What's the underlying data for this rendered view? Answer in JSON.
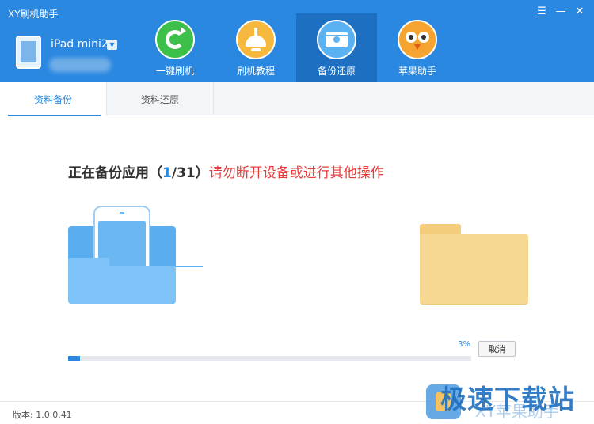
{
  "window": {
    "title": "XY刷机助手",
    "controls": [
      "menu-icon",
      "minimize-icon",
      "close-icon"
    ]
  },
  "device": {
    "name": "iPad mini2",
    "dropdown_glyph": "▼"
  },
  "nav": [
    {
      "label": "一键刷机",
      "icon": "refresh-icon",
      "color": "#3cc04a",
      "active": false
    },
    {
      "label": "刷机教程",
      "icon": "lamp-icon",
      "color": "#f7b83e",
      "active": false
    },
    {
      "label": "备份还原",
      "icon": "disk-icon",
      "color": "#5bb2f2",
      "active": true
    },
    {
      "label": "苹果助手",
      "icon": "owl-icon",
      "color": "#f5a430",
      "active": false
    }
  ],
  "tabs": [
    {
      "label": "资料备份",
      "active": true
    },
    {
      "label": "资料还原",
      "active": false
    }
  ],
  "status": {
    "prefix": "正在备份应用（",
    "current": "1",
    "separator": "/31",
    "suffix": "）",
    "warning": "请勿断开设备或进行其他操作"
  },
  "progress": {
    "percent_text": "3%",
    "value": 0.03
  },
  "cancel_label": "取消",
  "footer": {
    "version": "版本: 1.0.0.41"
  },
  "watermark": {
    "text": "极速下载站",
    "sub": "XY苹果助手"
  },
  "colors": {
    "accent": "#2a88e0",
    "warning": "#e83b3b",
    "header_bg": "#2a88e0"
  }
}
